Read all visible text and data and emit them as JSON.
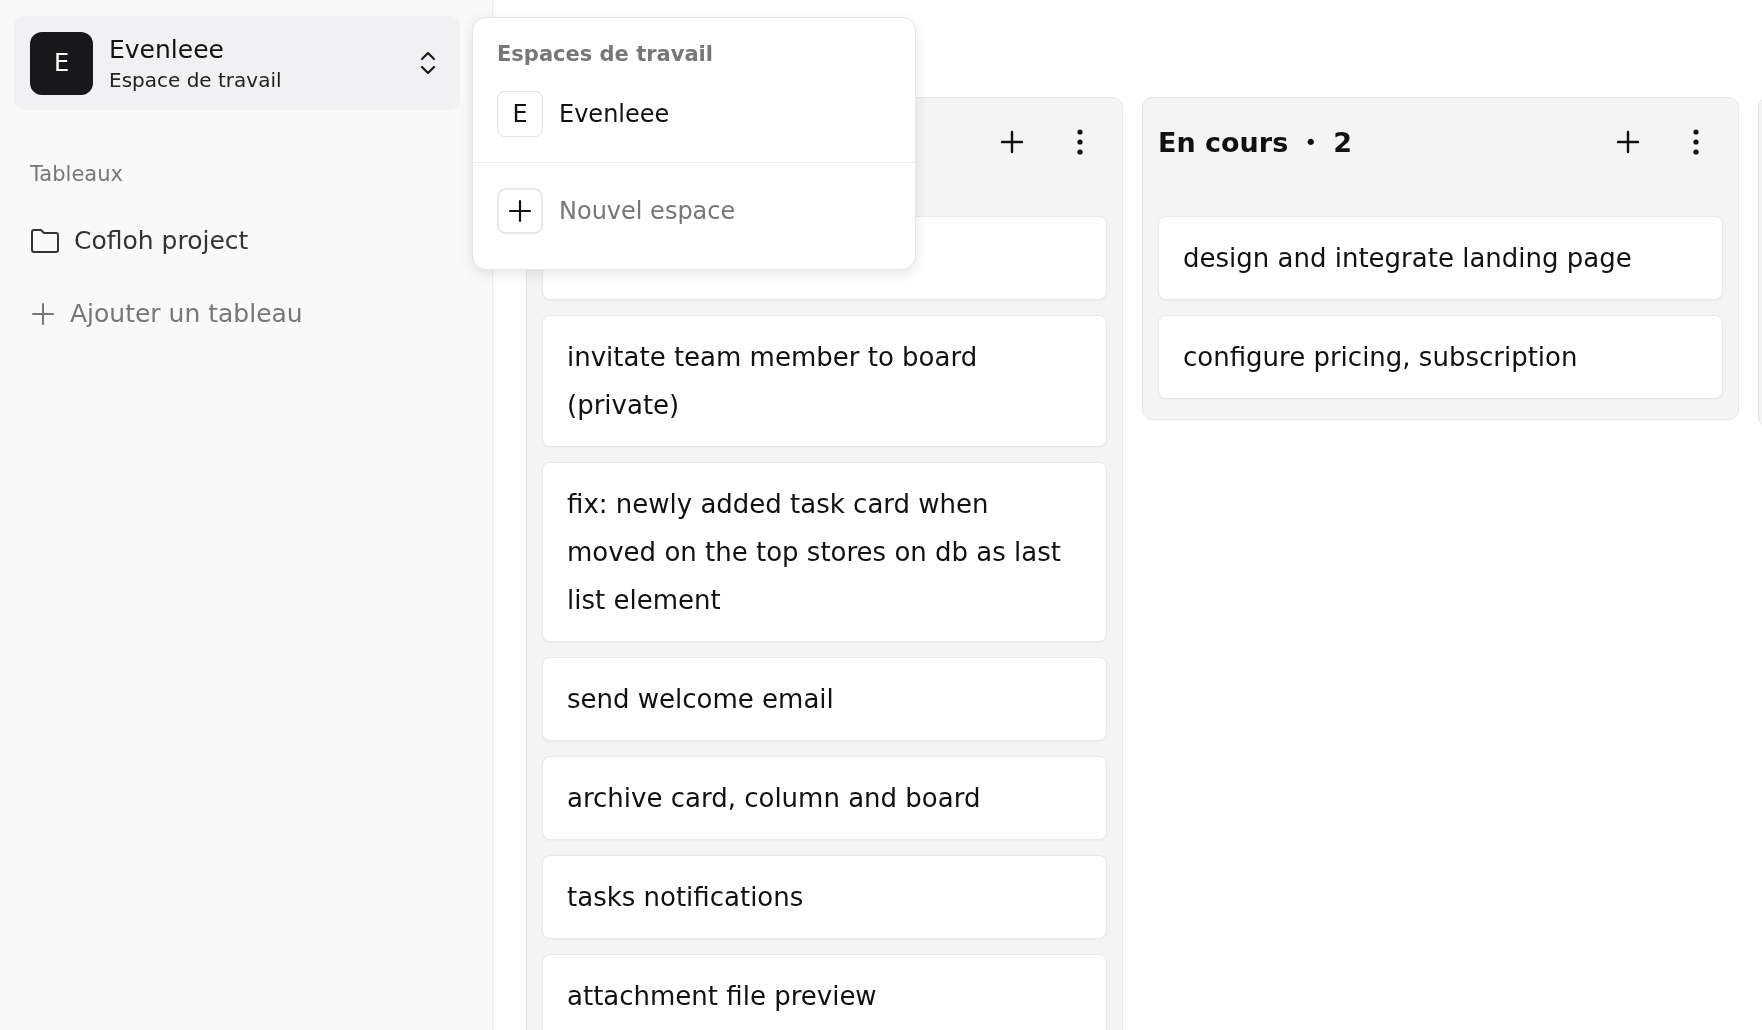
{
  "workspace_switcher": {
    "avatar": "E",
    "name": "Evenleee",
    "subtitle": "Espace de travail"
  },
  "sidebar": {
    "section_label": "Tableaux",
    "boards": [
      {
        "label": "Cofloh project"
      }
    ],
    "add_board": "Ajouter un tableau"
  },
  "workspace_menu": {
    "heading": "Espaces de travail",
    "workspaces": [
      {
        "avatar": "E",
        "name": "Evenleee"
      }
    ],
    "new_workspace": "Nouvel espace"
  },
  "columns": [
    {
      "kind": "list",
      "cards": [
        {
          "kind": "covered"
        },
        {
          "kind": "task",
          "title": "invitate team member to board (private)"
        },
        {
          "kind": "task",
          "title": "fix: newly added task card when moved on the top stores on db as last list element"
        },
        {
          "kind": "task",
          "title": "send welcome email"
        },
        {
          "kind": "task",
          "title": "archive card, column and board"
        },
        {
          "kind": "task",
          "title": "tasks notifications"
        },
        {
          "kind": "task",
          "title": "attachment file preview"
        }
      ]
    },
    {
      "kind": "list",
      "title": "En cours",
      "separator": "•",
      "count": "2",
      "cards": [
        {
          "kind": "task",
          "title": "design and integrate landing page"
        },
        {
          "kind": "task",
          "title": "configure pricing, subscription"
        }
      ]
    },
    {
      "kind": "edge"
    }
  ]
}
